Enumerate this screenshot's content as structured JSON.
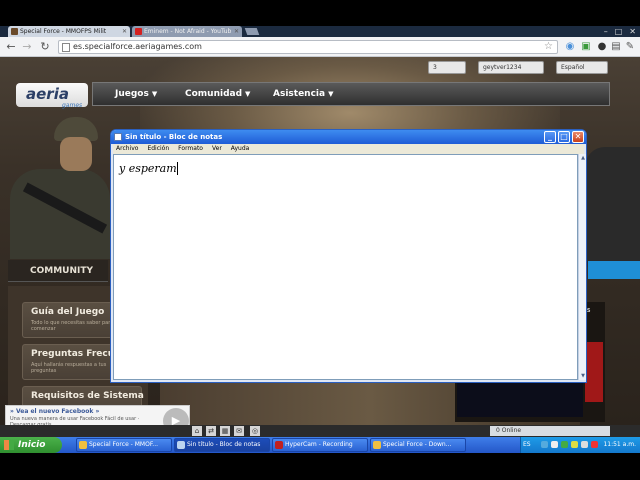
{
  "browser": {
    "tabs": [
      {
        "label": "Special Force - MMOFPS Milit",
        "active": true
      },
      {
        "label": "Eminem - Not Afraid - YouTub",
        "active": false
      }
    ],
    "url": "es.specialforce.aeriagames.com"
  },
  "site": {
    "logo": "aeria",
    "logo_sub": "games",
    "topbar": {
      "count": "3",
      "username": "geytver1234",
      "language": "Español"
    },
    "nav": [
      "Juegos",
      "Comunidad",
      "Asistencia"
    ],
    "community": "COMMUNITY",
    "side_items": [
      {
        "title": "Guía del Juego",
        "desc": "Todo lo que necesitas saber para comenzar"
      },
      {
        "title": "Preguntas Frecu",
        "desc": "Aquí hallarás respuestas a tus preguntas"
      },
      {
        "title": "Requisitos de Sistema",
        "desc": ""
      }
    ],
    "right_label": "AS"
  },
  "notepad": {
    "title": "Sin título - Bloc de notas",
    "menu": [
      "Archivo",
      "Edición",
      "Formato",
      "Ver",
      "Ayuda"
    ],
    "content": "y esperam"
  },
  "facebook": {
    "heading": "» Vea el nuevo Facebook »",
    "desc": "Una nueva manera de usar Facebook Fácil de usar · Descargar gratis"
  },
  "strip": {
    "online": "0 Online"
  },
  "taskbar": {
    "start": "Inicio",
    "tasks": [
      {
        "label": "Special Force - MMOF...",
        "active": false
      },
      {
        "label": "Sin título - Bloc de notas",
        "active": true
      },
      {
        "label": "HyperCam - Recording",
        "active": false
      },
      {
        "label": "Special Force - Down...",
        "active": false
      }
    ],
    "lang": "ES",
    "clock": "11:51 a.m."
  },
  "colors": {
    "taskbar": "#2457c8",
    "start": "#2f8f2f",
    "notepad_title": "#1f5cd6",
    "tray": "#1478cc"
  }
}
